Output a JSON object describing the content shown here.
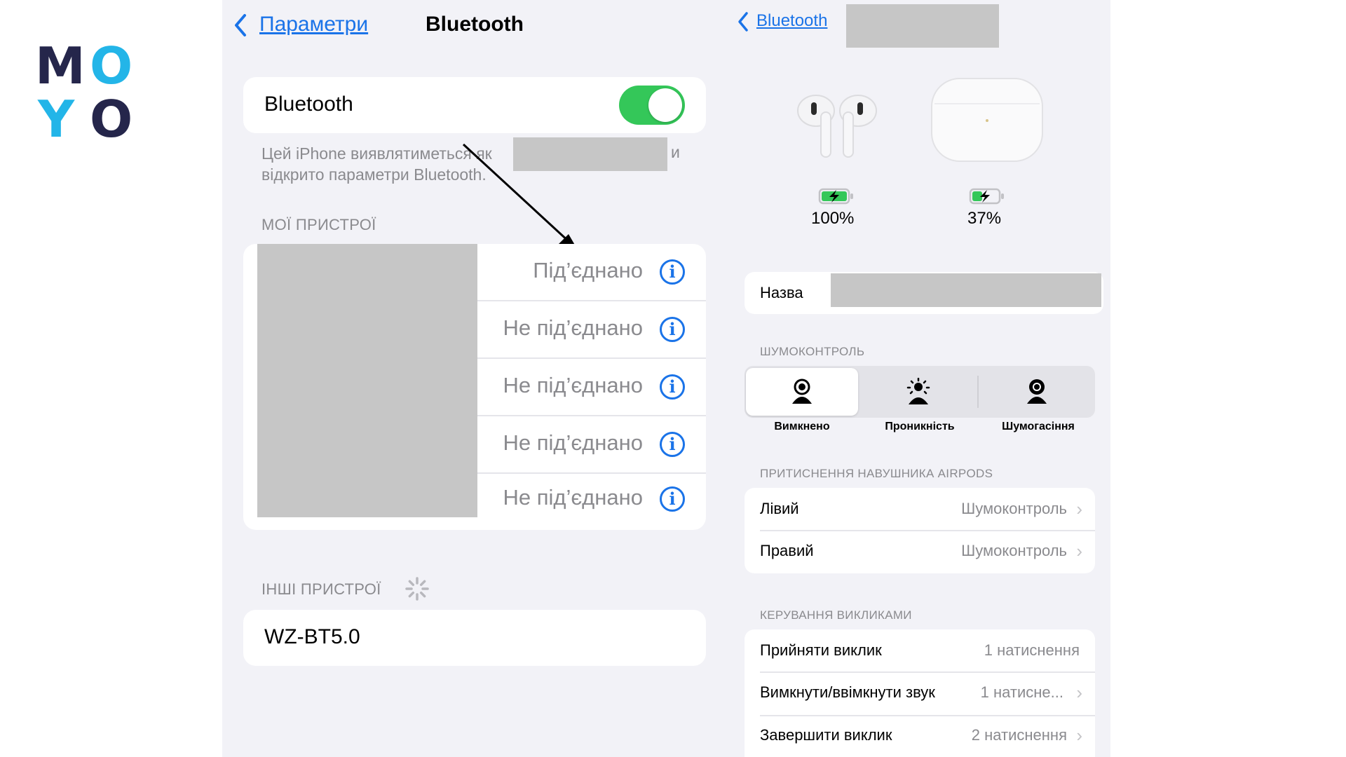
{
  "logo": {
    "letters": [
      "M",
      "O",
      "Y",
      "O"
    ],
    "colors": [
      "#25264b",
      "#23b5e8",
      "#23b5e8",
      "#25264b"
    ]
  },
  "left": {
    "back_label": "Параметри",
    "title": "Bluetooth",
    "toggle": {
      "label": "Bluetooth",
      "on": true,
      "color": "#34c759"
    },
    "discoverable": {
      "line1": "Цей iPhone виявлятиметься як",
      "line1_end": "и",
      "line2": "відкрито параметри Bluetooth."
    },
    "my_devices_header": "МОЇ ПРИСТРОЇ",
    "devices": [
      {
        "status": "Під’єднано"
      },
      {
        "status": "Не під’єднано"
      },
      {
        "status": "Не під’єднано"
      },
      {
        "status": "Не під’єднано"
      },
      {
        "status": "Не під’єднано"
      }
    ],
    "info_glyph": "i",
    "other_devices_header": "ІНШІ ПРИСТРОЇ",
    "other_device": "WZ-BT5.0"
  },
  "right": {
    "back_label": "Bluetooth",
    "earbuds_battery": "100%",
    "case_battery": "37%",
    "battery_color": "#34c759",
    "name_label": "Назва",
    "noise_header": "ШУМОКОНТРОЛЬ",
    "noise_modes": [
      {
        "label": "Вимкнено",
        "selected": true
      },
      {
        "label": "Проникність",
        "selected": false
      },
      {
        "label": "Шумогасіння",
        "selected": false
      }
    ],
    "press_header": "ПРИТИСНЕННЯ НАВУШНИКА AIRPODS",
    "press_rows": [
      {
        "label": "Лівий",
        "value": "Шумоконтроль"
      },
      {
        "label": "Правий",
        "value": "Шумоконтроль"
      }
    ],
    "calls_header": "КЕРУВАННЯ ВИКЛИКАМИ",
    "call_rows": [
      {
        "label": "Прийняти виклик",
        "value": "1 натиснення"
      },
      {
        "label": "Вимкнути/ввімкнути звук",
        "value": "1 натисне..."
      },
      {
        "label": "Завершити виклик",
        "value": "2 натиснення"
      }
    ],
    "chevron": "›"
  }
}
